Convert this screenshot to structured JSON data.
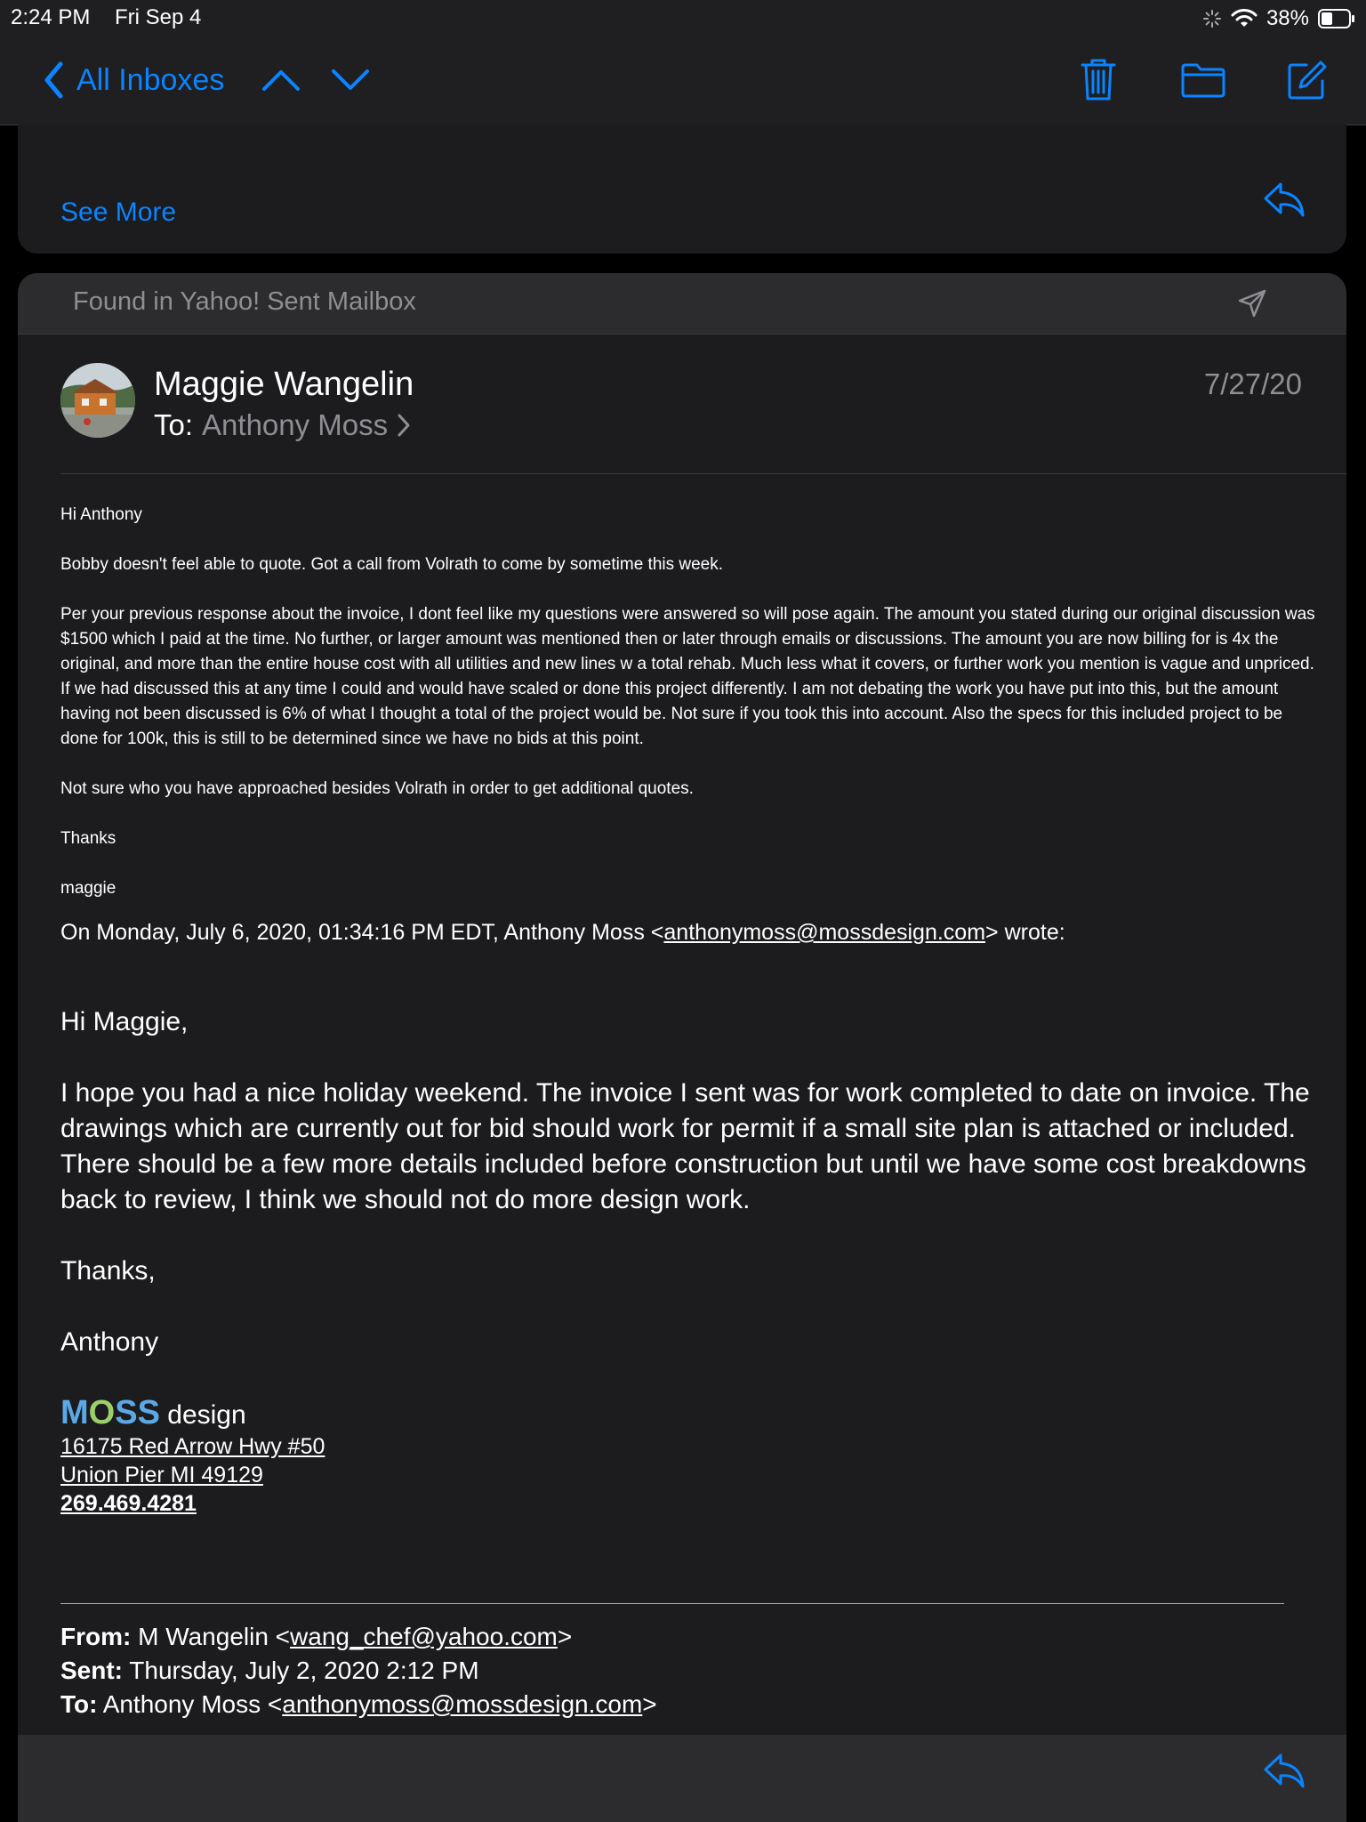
{
  "status_bar": {
    "time": "2:24 PM",
    "date": "Fri Sep 4",
    "battery": "38%"
  },
  "nav": {
    "back_label": "All Inboxes"
  },
  "colors": {
    "accent": "#0a84ff",
    "background": "#1c1c1e",
    "secondary_text": "#8e8e93"
  },
  "icons": [
    "back-chevron-icon",
    "up-arrow-icon",
    "down-arrow-icon",
    "trash-icon",
    "folder-icon",
    "compose-icon",
    "reply-icon",
    "paper-plane-icon",
    "wifi-icon",
    "battery-icon"
  ],
  "previous_message": {
    "see_more": "See More"
  },
  "message": {
    "mailbox_banner": "Found in Yahoo! Sent Mailbox",
    "sender": "Maggie Wangelin",
    "to_label": "To:",
    "to_name": "Anthony Moss",
    "date": "7/27/20",
    "body": {
      "greeting": "Hi Anthony",
      "p1": "Bobby doesn't feel able to quote. Got a call from Volrath to come by sometime this week.",
      "p2": "Per your previous response about the invoice, I dont feel like my questions were answered so will pose again.  The amount you stated during our original discussion was $1500 which I paid at the time.  No further, or larger amount was mentioned then or later through emails or discussions. The amount you are now billing for is 4x the original, and more than the entire house cost with all utilities and new lines w a total rehab. Much less what it covers, or further work you mention is vague and unpriced.  If we had discussed this at any time I could and would have scaled or done this project differently.  I am not debating the work you have put into this, but the amount having not been discussed is 6% of what I thought a total of the project would be. Not sure if you took this into account. Also the specs for this included project to be done for 100k, this is still to be determined since we have no bids at this point.",
      "p3": "Not sure who you have approached besides Volrath in order to get additional quotes.",
      "thanks": "Thanks",
      "signoff": "maggie"
    },
    "quote_header": {
      "prefix": "On Monday, July 6, 2020, 01:34:16 PM EDT, Anthony Moss <",
      "email": "anthonymoss@mossdesign.com",
      "suffix": "> wrote:"
    },
    "quoted": {
      "greeting": "Hi Maggie,",
      "p1": "I hope you had a nice holiday weekend. The invoice I sent was for work completed to date on invoice. The drawings which are currently out for bid should work for permit if a small site plan is attached or included. There should be a few more details included before construction but until we have some cost breakdowns back to review, I think we should not do more design work.",
      "thanks": "Thanks,",
      "name": "Anthony",
      "logo_m": "M",
      "logo_o": "O",
      "logo_ss": "SS",
      "logo_design": " design",
      "address1": "16175 Red Arrow Hwy #50",
      "address2": "Union Pier MI 49129",
      "phone": "269.469.4281"
    },
    "forwarded": {
      "from_label": "From:",
      "from_name": " M Wangelin <",
      "from_email": "wang_chef@yahoo.com",
      "from_close": ">",
      "sent_label": "Sent:",
      "sent_value": " Thursday, July 2, 2020 2:12 PM",
      "to_label": "To:",
      "to_name": " Anthony Moss <",
      "to_email": "anthonymoss@mossdesign.com",
      "to_close": ">"
    }
  }
}
